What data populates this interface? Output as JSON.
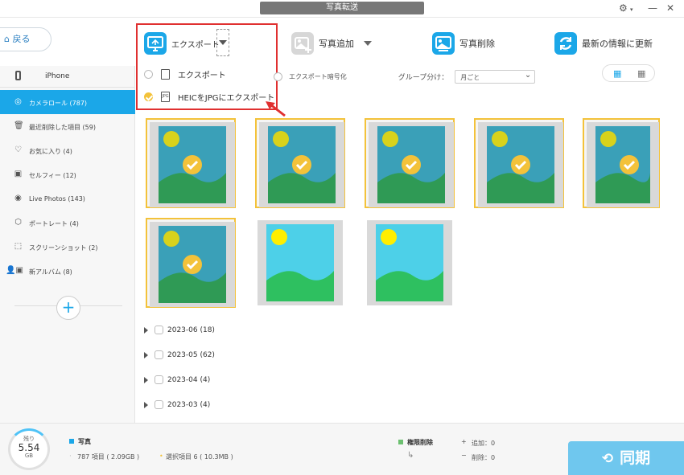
{
  "window": {
    "title": "写真転送"
  },
  "toolbar": {
    "back_label": "戻る",
    "export_label": "エクスポート",
    "add_photo_label": "写真追加",
    "delete_photo_label": "写真削除",
    "refresh_label": "最新の情報に更新"
  },
  "export_menu": {
    "items": [
      {
        "label": "エクスポート",
        "selected": false
      },
      {
        "label": "HEICをJPGにエクスポート",
        "selected": true
      }
    ]
  },
  "sidebar": {
    "device_name": "iPhone",
    "items": [
      {
        "label": "カメラロール (787)",
        "icon": "camera-icon",
        "active": true
      },
      {
        "label": "最近削除した項目 (59)",
        "icon": "trash-icon",
        "active": false
      },
      {
        "label": "お気に入り (4)",
        "icon": "heart-icon",
        "active": false
      },
      {
        "label": "セルフィー (12)",
        "icon": "portrait-icon",
        "active": false
      },
      {
        "label": "Live Photos (143)",
        "icon": "live-photo-icon",
        "active": false
      },
      {
        "label": "ポートレート (4)",
        "icon": "cube-icon",
        "active": false
      },
      {
        "label": "スクリーンショット (2)",
        "icon": "screenshot-icon",
        "active": false
      },
      {
        "label": "新アルバム (8)",
        "icon": "album-icon",
        "active": false
      }
    ]
  },
  "filters": {
    "encrypt_label": "エクスポート暗号化",
    "group_label": "グループ分け：",
    "group_value": "月ごと"
  },
  "photos": [
    {
      "selected": true
    },
    {
      "selected": true
    },
    {
      "selected": true
    },
    {
      "selected": true
    },
    {
      "selected": true
    },
    {
      "selected": true
    },
    {
      "selected": false
    },
    {
      "selected": false
    }
  ],
  "groups": [
    {
      "label": "2023-06 (18)"
    },
    {
      "label": "2023-05 (62)"
    },
    {
      "label": "2023-04 (4)"
    },
    {
      "label": "2023-03 (4)"
    }
  ],
  "status": {
    "remaining_label": "残り",
    "remaining_value": "5.54",
    "remaining_unit": "GB",
    "category": "写真",
    "total_items": "787 項目 ( 2.09GB )",
    "selected_items": "選択項目 6 ( 10.3MB )",
    "permission_delete": "権限削除",
    "added": "追加：0",
    "deleted": "削除：0",
    "sync_label": "同期"
  },
  "colors": {
    "accent": "#1ba7e8",
    "selection": "#f3c23a",
    "highlight_border": "#e03030"
  }
}
